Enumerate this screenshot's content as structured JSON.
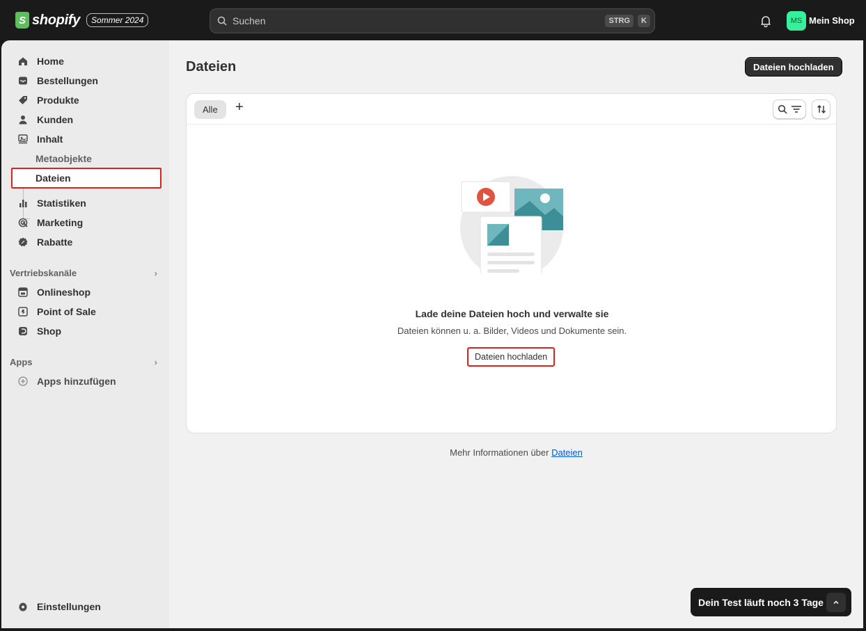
{
  "topbar": {
    "logo_text": "shopify",
    "logo_letter": "S",
    "edition": "Sommer 2024",
    "search_placeholder": "Suchen",
    "shortcut_keys": [
      "STRG",
      "K"
    ],
    "avatar_initials": "MS",
    "shop_name": "Mein Shop"
  },
  "sidebar": {
    "items": [
      {
        "label": "Home",
        "icon": "home-icon"
      },
      {
        "label": "Bestellungen",
        "icon": "inbox-icon"
      },
      {
        "label": "Produkte",
        "icon": "tag-icon"
      },
      {
        "label": "Kunden",
        "icon": "person-icon"
      },
      {
        "label": "Inhalt",
        "icon": "content-icon"
      }
    ],
    "sub_items": [
      {
        "label": "Metaobjekte"
      },
      {
        "label": "Dateien",
        "active": true
      }
    ],
    "items2": [
      {
        "label": "Statistiken",
        "icon": "chart-icon"
      },
      {
        "label": "Marketing",
        "icon": "target-icon"
      },
      {
        "label": "Rabatte",
        "icon": "discount-icon"
      }
    ],
    "sales_channels_heading": "Vertriebskanäle",
    "sales_channels": [
      {
        "label": "Onlineshop",
        "icon": "store-icon"
      },
      {
        "label": "Point of Sale",
        "icon": "pos-icon"
      },
      {
        "label": "Shop",
        "icon": "shop-icon"
      }
    ],
    "apps_heading": "Apps",
    "add_apps": "Apps hinzufügen",
    "settings": "Einstellungen"
  },
  "main": {
    "title": "Dateien",
    "upload_button": "Dateien hochladen",
    "tabs": [
      {
        "label": "Alle"
      }
    ],
    "add_tab": "+",
    "empty": {
      "title": "Lade deine Dateien hoch und verwalte sie",
      "subtitle": "Dateien können u. a. Bilder, Videos und Dokumente sein.",
      "button": "Dateien hochladen"
    },
    "more_info_prefix": "Mehr Informationen über ",
    "more_info_link": "Dateien"
  },
  "toast": {
    "text": "Dein Test läuft noch 3 Tage"
  },
  "colors": {
    "accent_green": "#36f09b",
    "highlight_red": "#e0201a",
    "link_blue": "#005bd3"
  }
}
